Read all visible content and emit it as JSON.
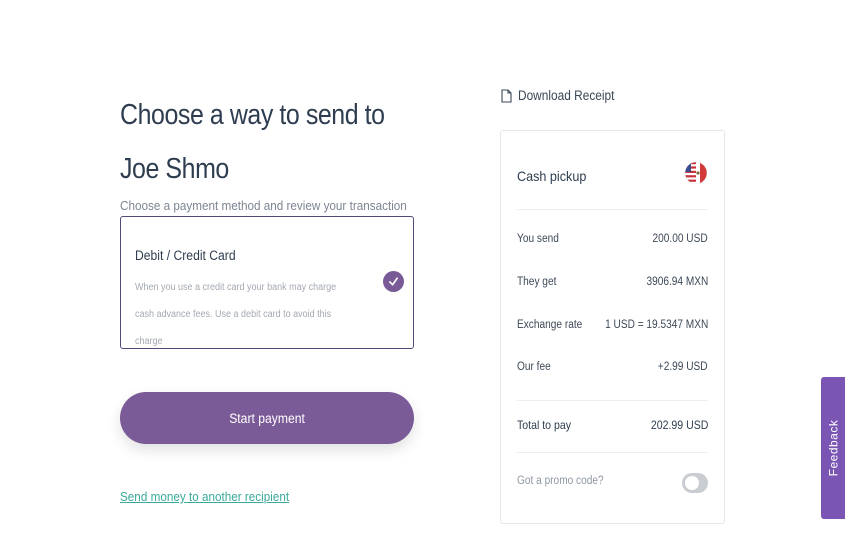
{
  "header": {
    "title": "Choose a way to send to Joe Shmo",
    "subtitle": "Choose a payment method and review your transaction"
  },
  "payment_method": {
    "title": "Debit / Credit Card",
    "description": "When you use a credit card your bank may charge cash advance fees. Use a debit card to avoid this charge",
    "selected": true
  },
  "actions": {
    "start_payment": "Start payment",
    "send_another": "Send money to another recipient",
    "download_receipt": "Download Receipt"
  },
  "summary": {
    "title": "Cash pickup",
    "flag_icon": "usa-mexico-flag-icon",
    "rows": [
      {
        "label": "You send",
        "value": "200.00 USD"
      },
      {
        "label": "They get",
        "value": "3906.94 MXN"
      },
      {
        "label": "Exchange rate",
        "value": "1 USD = 19.5347 MXN"
      },
      {
        "label": "Our fee",
        "value": "+2.99 USD"
      }
    ],
    "total": {
      "label": "Total to pay",
      "value": "202.99 USD"
    },
    "promo": {
      "label": "Got a promo code?",
      "enabled": false
    }
  },
  "feedback": {
    "label": "Feedback"
  },
  "colors": {
    "primary": "#7b5b97",
    "link": "#3aa99b",
    "feedback": "#7a55b3"
  }
}
